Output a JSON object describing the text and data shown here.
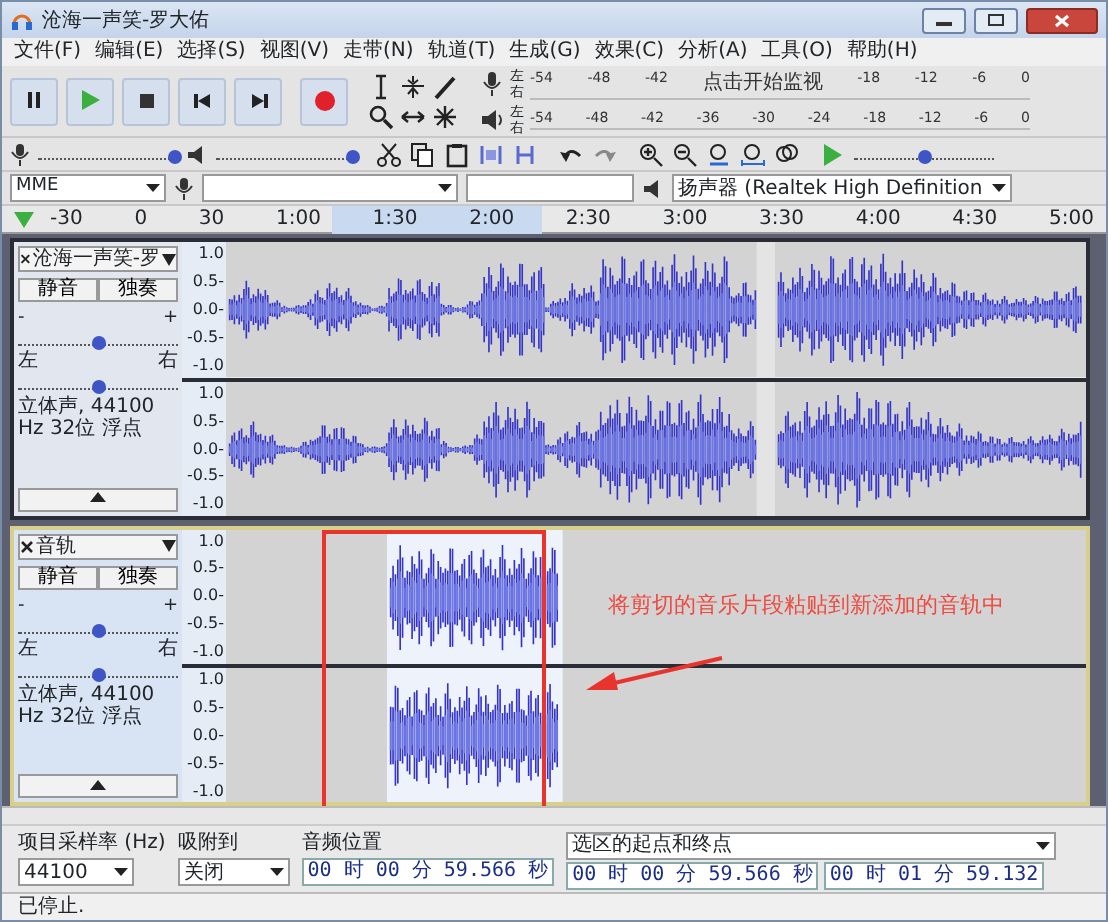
{
  "window": {
    "title": "沧海一声笑-罗大佑"
  },
  "menu": [
    "文件(F)",
    "编辑(E)",
    "选择(S)",
    "视图(V)",
    "走带(N)",
    "轨道(T)",
    "生成(G)",
    "效果(C)",
    "分析(A)",
    "工具(O)",
    "帮助(H)"
  ],
  "meters": [
    {
      "side_labels": [
        "左",
        "右"
      ],
      "scale": [
        "-54",
        "-48",
        "-42",
        "点击开始监视",
        "-18",
        "-12",
        "-6",
        "0"
      ]
    },
    {
      "side_labels": [
        "左",
        "右"
      ],
      "scale": [
        "-54",
        "-48",
        "-42",
        "-36",
        "-30",
        "-24",
        "-18",
        "-12",
        "-6",
        "0"
      ]
    }
  ],
  "sliders": {
    "input_volume": {
      "level": 0.97
    },
    "output_volume": {
      "level": 0.97
    },
    "play_speed": {
      "level": 0.5
    }
  },
  "devices": {
    "host": "MME",
    "output": "扬声器 (Realtek High Definition"
  },
  "ruler": [
    "-30",
    "0",
    "30",
    "1:00",
    "1:30",
    "2:00",
    "2:30",
    "3:00",
    "3:30",
    "4:00",
    "4:30",
    "5:00"
  ],
  "tracks": [
    {
      "name": "沧海一声笑-罗",
      "selected": false,
      "mute": "静音",
      "solo": "独奏",
      "gain": {
        "level": 0.5
      },
      "pan": {
        "level": 0.5
      },
      "gain_labels": [
        "-",
        "+"
      ],
      "pan_labels": [
        "左",
        "右"
      ],
      "info": "立体声, 44100 Hz 32位 浮点",
      "channels": [
        {
          "axis": [
            "1.0",
            "0.5-",
            "0.0-",
            "-0.5-",
            "-1.0"
          ]
        },
        {
          "axis": [
            "1.0",
            "0.5-",
            "0.0-",
            "-0.5-",
            "-1.0"
          ]
        }
      ]
    },
    {
      "name": "音轨",
      "selected": true,
      "mute": "静音",
      "solo": "独奏",
      "gain": {
        "level": 0.5
      },
      "pan": {
        "level": 0.5
      },
      "gain_labels": [
        "-",
        "+"
      ],
      "pan_labels": [
        "左",
        "右"
      ],
      "info": "立体声, 44100 Hz 32位 浮点",
      "channels": [
        {
          "axis": [
            "1.0",
            "0.5-",
            "0.0-",
            "-0.5-",
            "-1.0"
          ]
        },
        {
          "axis": [
            "1.0",
            "0.5-",
            "0.0-",
            "-0.5-",
            "-1.0"
          ]
        }
      ]
    }
  ],
  "annotation": {
    "text": "将剪切的音乐片段粘贴到新添加的音轨中"
  },
  "selection_toolbar": {
    "rate_label": "项目采样率 (Hz)",
    "rate": "44100",
    "snap_label": "吸附到",
    "snap": "关闭",
    "position_label": "音频位置",
    "position": "00 时 00 分 59.566 秒",
    "selection_mode": "选区的起点和终点",
    "start": "00 时 00 分 59.566 秒",
    "end": "00 时 01 分 59.132"
  },
  "status_bar": {
    "text": "已停止."
  }
}
